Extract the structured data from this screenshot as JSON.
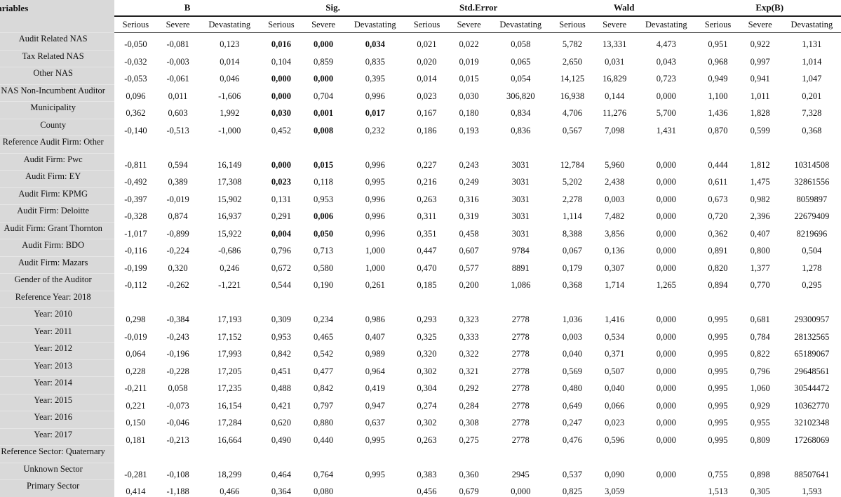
{
  "table": {
    "variables_header": "Variables",
    "groups": [
      "B",
      "Sig.",
      "Std.Error",
      "Wald",
      "Exp(B)"
    ],
    "subheaders": [
      "Serious",
      "Severe",
      "Devastating"
    ],
    "rows": [
      {
        "label": "Audit Related NAS",
        "B": [
          "-0,050",
          "-0,081",
          "0,123"
        ],
        "Sig": [
          "0,016",
          "0,000",
          "0,034"
        ],
        "Sig_bold": [
          true,
          true,
          true
        ],
        "SE": [
          "0,021",
          "0,022",
          "0,058"
        ],
        "Wald": [
          "5,782",
          "13,331",
          "4,473"
        ],
        "ExpB": [
          "0,951",
          "0,922",
          "1,131"
        ]
      },
      {
        "label": "Tax Related NAS",
        "B": [
          "-0,032",
          "-0,003",
          "0,014"
        ],
        "Sig": [
          "0,104",
          "0,859",
          "0,835"
        ],
        "Sig_bold": [
          false,
          false,
          false
        ],
        "SE": [
          "0,020",
          "0,019",
          "0,065"
        ],
        "Wald": [
          "2,650",
          "0,031",
          "0,043"
        ],
        "ExpB": [
          "0,968",
          "0,997",
          "1,014"
        ]
      },
      {
        "label": "Other NAS",
        "B": [
          "-0,053",
          "-0,061",
          "0,046"
        ],
        "Sig": [
          "0,000",
          "0,000",
          "0,395"
        ],
        "Sig_bold": [
          true,
          true,
          false
        ],
        "SE": [
          "0,014",
          "0,015",
          "0,054"
        ],
        "Wald": [
          "14,125",
          "16,829",
          "0,723"
        ],
        "ExpB": [
          "0,949",
          "0,941",
          "1,047"
        ]
      },
      {
        "label": "NAS Non-Incumbent Auditor",
        "B": [
          "0,096",
          "0,011",
          "-1,606"
        ],
        "Sig": [
          "0,000",
          "0,704",
          "0,996"
        ],
        "Sig_bold": [
          true,
          false,
          false
        ],
        "SE": [
          "0,023",
          "0,030",
          "306,820"
        ],
        "Wald": [
          "16,938",
          "0,144",
          "0,000"
        ],
        "ExpB": [
          "1,100",
          "1,011",
          "0,201"
        ]
      },
      {
        "label": "Municipality",
        "B": [
          "0,362",
          "0,603",
          "1,992"
        ],
        "Sig": [
          "0,030",
          "0,001",
          "0,017"
        ],
        "Sig_bold": [
          true,
          true,
          true
        ],
        "SE": [
          "0,167",
          "0,180",
          "0,834"
        ],
        "Wald": [
          "4,706",
          "11,276",
          "5,700"
        ],
        "ExpB": [
          "1,436",
          "1,828",
          "7,328"
        ]
      },
      {
        "label": "County",
        "B": [
          "-0,140",
          "-0,513",
          "-1,000"
        ],
        "Sig": [
          "0,452",
          "0,008",
          "0,232"
        ],
        "Sig_bold": [
          false,
          true,
          false
        ],
        "SE": [
          "0,186",
          "0,193",
          "0,836"
        ],
        "Wald": [
          "0,567",
          "7,098",
          "1,431"
        ],
        "ExpB": [
          "0,870",
          "0,599",
          "0,368"
        ]
      },
      {
        "label": "Reference Audit Firm: Other",
        "B": [
          "",
          "",
          ""
        ],
        "Sig": [
          "",
          "",
          ""
        ],
        "Sig_bold": [
          false,
          false,
          false
        ],
        "SE": [
          "",
          "",
          ""
        ],
        "Wald": [
          "",
          "",
          ""
        ],
        "ExpB": [
          "",
          "",
          ""
        ]
      },
      {
        "label": "Audit Firm: Pwc",
        "B": [
          "-0,811",
          "0,594",
          "16,149"
        ],
        "Sig": [
          "0,000",
          "0,015",
          "0,996"
        ],
        "Sig_bold": [
          true,
          true,
          false
        ],
        "SE": [
          "0,227",
          "0,243",
          "3031"
        ],
        "Wald": [
          "12,784",
          "5,960",
          "0,000"
        ],
        "ExpB": [
          "0,444",
          "1,812",
          "10314508"
        ]
      },
      {
        "label": "Audit Firm: EY",
        "B": [
          "-0,492",
          "0,389",
          "17,308"
        ],
        "Sig": [
          "0,023",
          "0,118",
          "0,995"
        ],
        "Sig_bold": [
          true,
          false,
          false
        ],
        "SE": [
          "0,216",
          "0,249",
          "3031"
        ],
        "Wald": [
          "5,202",
          "2,438",
          "0,000"
        ],
        "ExpB": [
          "0,611",
          "1,475",
          "32861556"
        ]
      },
      {
        "label": "Audit Firm: KPMG",
        "B": [
          "-0,397",
          "-0,019",
          "15,902"
        ],
        "Sig": [
          "0,131",
          "0,953",
          "0,996"
        ],
        "Sig_bold": [
          false,
          false,
          false
        ],
        "SE": [
          "0,263",
          "0,316",
          "3031"
        ],
        "Wald": [
          "2,278",
          "0,003",
          "0,000"
        ],
        "ExpB": [
          "0,673",
          "0,982",
          "8059897"
        ]
      },
      {
        "label": "Audit Firm: Deloitte",
        "B": [
          "-0,328",
          "0,874",
          "16,937"
        ],
        "Sig": [
          "0,291",
          "0,006",
          "0,996"
        ],
        "Sig_bold": [
          false,
          true,
          false
        ],
        "SE": [
          "0,311",
          "0,319",
          "3031"
        ],
        "Wald": [
          "1,114",
          "7,482",
          "0,000"
        ],
        "ExpB": [
          "0,720",
          "2,396",
          "22679409"
        ]
      },
      {
        "label": "Audit Firm: Grant Thornton",
        "B": [
          "-1,017",
          "-0,899",
          "15,922"
        ],
        "Sig": [
          "0,004",
          "0,050",
          "0,996"
        ],
        "Sig_bold": [
          true,
          true,
          false
        ],
        "SE": [
          "0,351",
          "0,458",
          "3031"
        ],
        "Wald": [
          "8,388",
          "3,856",
          "0,000"
        ],
        "ExpB": [
          "0,362",
          "0,407",
          "8219696"
        ]
      },
      {
        "label": "Audit Firm: BDO",
        "B": [
          "-0,116",
          "-0,224",
          "-0,686"
        ],
        "Sig": [
          "0,796",
          "0,713",
          "1,000"
        ],
        "Sig_bold": [
          false,
          false,
          false
        ],
        "SE": [
          "0,447",
          "0,607",
          "9784"
        ],
        "Wald": [
          "0,067",
          "0,136",
          "0,000"
        ],
        "ExpB": [
          "0,891",
          "0,800",
          "0,504"
        ]
      },
      {
        "label": "Audit Firm: Mazars",
        "B": [
          "-0,199",
          "0,320",
          "0,246"
        ],
        "Sig": [
          "0,672",
          "0,580",
          "1,000"
        ],
        "Sig_bold": [
          false,
          false,
          false
        ],
        "SE": [
          "0,470",
          "0,577",
          "8891"
        ],
        "Wald": [
          "0,179",
          "0,307",
          "0,000"
        ],
        "ExpB": [
          "0,820",
          "1,377",
          "1,278"
        ]
      },
      {
        "label": "Gender of the Auditor",
        "B": [
          "-0,112",
          "-0,262",
          "-1,221"
        ],
        "Sig": [
          "0,544",
          "0,190",
          "0,261"
        ],
        "Sig_bold": [
          false,
          false,
          false
        ],
        "SE": [
          "0,185",
          "0,200",
          "1,086"
        ],
        "Wald": [
          "0,368",
          "1,714",
          "1,265"
        ],
        "ExpB": [
          "0,894",
          "0,770",
          "0,295"
        ]
      },
      {
        "label": "Reference Year: 2018",
        "B": [
          "",
          "",
          ""
        ],
        "Sig": [
          "",
          "",
          ""
        ],
        "Sig_bold": [
          false,
          false,
          false
        ],
        "SE": [
          "",
          "",
          ""
        ],
        "Wald": [
          "",
          "",
          ""
        ],
        "ExpB": [
          "",
          "",
          ""
        ]
      },
      {
        "label": "Year: 2010",
        "B": [
          "0,298",
          "-0,384",
          "17,193"
        ],
        "Sig": [
          "0,309",
          "0,234",
          "0,986"
        ],
        "Sig_bold": [
          false,
          false,
          false
        ],
        "SE": [
          "0,293",
          "0,323",
          "2778"
        ],
        "Wald": [
          "1,036",
          "1,416",
          "0,000"
        ],
        "ExpB": [
          "0,995",
          "0,681",
          "29300957"
        ]
      },
      {
        "label": "Year: 2011",
        "B": [
          "-0,019",
          "-0,243",
          "17,152"
        ],
        "Sig": [
          "0,953",
          "0,465",
          "0,407"
        ],
        "Sig_bold": [
          false,
          false,
          false
        ],
        "SE": [
          "0,325",
          "0,333",
          "2778"
        ],
        "Wald": [
          "0,003",
          "0,534",
          "0,000"
        ],
        "ExpB": [
          "0,995",
          "0,784",
          "28132565"
        ]
      },
      {
        "label": "Year: 2012",
        "B": [
          "0,064",
          "-0,196",
          "17,993"
        ],
        "Sig": [
          "0,842",
          "0,542",
          "0,989"
        ],
        "Sig_bold": [
          false,
          false,
          false
        ],
        "SE": [
          "0,320",
          "0,322",
          "2778"
        ],
        "Wald": [
          "0,040",
          "0,371",
          "0,000"
        ],
        "ExpB": [
          "0,995",
          "0,822",
          "65189067"
        ]
      },
      {
        "label": "Year: 2013",
        "B": [
          "0,228",
          "-0,228",
          "17,205"
        ],
        "Sig": [
          "0,451",
          "0,477",
          "0,964"
        ],
        "Sig_bold": [
          false,
          false,
          false
        ],
        "SE": [
          "0,302",
          "0,321",
          "2778"
        ],
        "Wald": [
          "0,569",
          "0,507",
          "0,000"
        ],
        "ExpB": [
          "0,995",
          "0,796",
          "29648561"
        ]
      },
      {
        "label": "Year: 2014",
        "B": [
          "-0,211",
          "0,058",
          "17,235"
        ],
        "Sig": [
          "0,488",
          "0,842",
          "0,419"
        ],
        "Sig_bold": [
          false,
          false,
          false
        ],
        "SE": [
          "0,304",
          "0,292",
          "2778"
        ],
        "Wald": [
          "0,480",
          "0,040",
          "0,000"
        ],
        "ExpB": [
          "0,995",
          "1,060",
          "30544472"
        ]
      },
      {
        "label": "Year: 2015",
        "B": [
          "0,221",
          "-0,073",
          "16,154"
        ],
        "Sig": [
          "0,421",
          "0,797",
          "0,947"
        ],
        "Sig_bold": [
          false,
          false,
          false
        ],
        "SE": [
          "0,274",
          "0,284",
          "2778"
        ],
        "Wald": [
          "0,649",
          "0,066",
          "0,000"
        ],
        "ExpB": [
          "0,995",
          "0,929",
          "10362770"
        ]
      },
      {
        "label": "Year: 2016",
        "B": [
          "0,150",
          "-0,046",
          "17,284"
        ],
        "Sig": [
          "0,620",
          "0,880",
          "0,637"
        ],
        "Sig_bold": [
          false,
          false,
          false
        ],
        "SE": [
          "0,302",
          "0,308",
          "2778"
        ],
        "Wald": [
          "0,247",
          "0,023",
          "0,000"
        ],
        "ExpB": [
          "0,995",
          "0,955",
          "32102348"
        ]
      },
      {
        "label": "Year: 2017",
        "B": [
          "0,181",
          "-0,213",
          "16,664"
        ],
        "Sig": [
          "0,490",
          "0,440",
          "0,995"
        ],
        "Sig_bold": [
          false,
          false,
          false
        ],
        "SE": [
          "0,263",
          "0,275",
          "2778"
        ],
        "Wald": [
          "0,476",
          "0,596",
          "0,000"
        ],
        "ExpB": [
          "0,995",
          "0,809",
          "17268069"
        ]
      },
      {
        "label": "Reference Sector: Quaternary",
        "B": [
          "",
          "",
          ""
        ],
        "Sig": [
          "",
          "",
          ""
        ],
        "Sig_bold": [
          false,
          false,
          false
        ],
        "SE": [
          "",
          "",
          ""
        ],
        "Wald": [
          "",
          "",
          ""
        ],
        "ExpB": [
          "",
          "",
          ""
        ]
      },
      {
        "label": "Unknown Sector",
        "B": [
          "-0,281",
          "-0,108",
          "18,299"
        ],
        "Sig": [
          "0,464",
          "0,764",
          "0,995"
        ],
        "Sig_bold": [
          false,
          false,
          false
        ],
        "SE": [
          "0,383",
          "0,360",
          "2945"
        ],
        "Wald": [
          "0,537",
          "0,090",
          "0,000"
        ],
        "ExpB": [
          "0,755",
          "0,898",
          "88507641"
        ]
      },
      {
        "label": "Primary Sector",
        "B": [
          "0,414",
          "-1,188",
          "0,466"
        ],
        "Sig": [
          "0,364",
          "0,080",
          ""
        ],
        "Sig_bold": [
          false,
          false,
          false
        ],
        "SE": [
          "0,456",
          "0,679",
          "0,000"
        ],
        "Wald": [
          "0,825",
          "3,059",
          ""
        ],
        "ExpB": [
          "1,513",
          "0,305",
          "1,593"
        ]
      }
    ]
  }
}
